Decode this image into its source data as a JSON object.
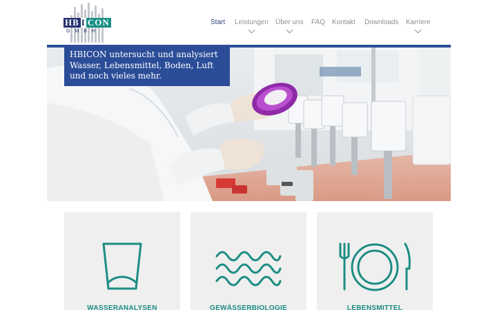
{
  "logo": {
    "part1": "HB",
    "part2": "I",
    "part3": "CON",
    "sub": "GMBH"
  },
  "nav": {
    "items": [
      {
        "label": "Start",
        "active": true,
        "dropdown": false
      },
      {
        "label": "Leistungen",
        "active": false,
        "dropdown": true
      },
      {
        "label": "Über uns",
        "active": false,
        "dropdown": true
      },
      {
        "label": "FAQ",
        "active": false,
        "dropdown": false
      },
      {
        "label": "Kontakt",
        "active": false,
        "dropdown": false
      },
      {
        "label": "Downloads",
        "active": false,
        "dropdown": false
      },
      {
        "label": "Karriere",
        "active": false,
        "dropdown": true
      }
    ]
  },
  "hero": {
    "caption": "HBICON untersucht und analysiert Wasser, Lebensmittel, Boden, Luft und noch vieles mehr."
  },
  "cards": [
    {
      "label": "WASSERANALYSEN",
      "icon": "water-glass-icon"
    },
    {
      "label": "GEWÄSSERBIOLOGIE",
      "icon": "waves-icon"
    },
    {
      "label": "LEBENSMITTEL",
      "icon": "plate-cutlery-icon"
    }
  ],
  "colors": {
    "brand_blue": "#2b4d98",
    "teal": "#1b8c82",
    "nav_active": "#2e3f7a"
  }
}
